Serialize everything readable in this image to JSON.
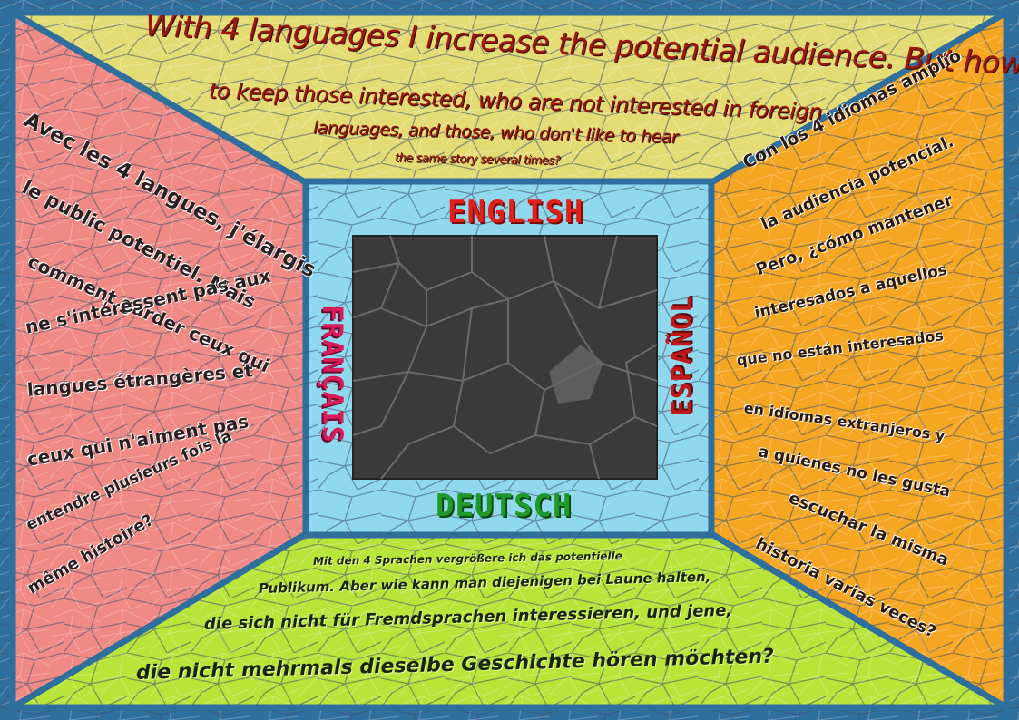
{
  "top_text": {
    "lines": [
      "With 4 languages I increase the potential audience. But how",
      "to keep those interested, who are not interested in foreign",
      "languages, and those, who don't like to hear",
      "the same story several times?"
    ]
  },
  "french_text": {
    "lines": [
      "Avec les 4 langues, j'élargis",
      "le public potentiel. Mais",
      "comment garder ceux qui",
      "ne s'intéressent pas aux",
      "langues étrangères et",
      "ceux qui n'aiment pas",
      "entendre plusieurs fois la",
      "même histoire?"
    ]
  },
  "spanish_text": {
    "lines": [
      "Con los 4 idiomas amplío",
      "la audiencia potencial.",
      "Pero, ¿cómo mantener",
      "interesados a aquellos",
      "que no están interesados",
      "en idiomas extranjeros y",
      "a quienes no les gusta",
      "escuchar la misma",
      "historia varias veces?"
    ]
  },
  "german_text": {
    "lines": [
      "Mit den 4 Sprachen vergrößere ich das potentielle",
      "Publikum. Aber wie kann man diejenigen bei Laune halten,",
      "die sich nicht für Fremdsprachen interessieren, und jene,",
      "die nicht mehrmals dieselbe Geschichte hören möchten?"
    ]
  },
  "labels": {
    "english": "ENGLISH",
    "francais": "FRANÇAIS",
    "espanol": "ESPAÑOL",
    "deutsch": "DEUTSCH"
  },
  "colors": {
    "frame": "#2f6f9e",
    "top_wall": "#e3dc74",
    "left_wall": "#f08a85",
    "right_wall": "#f5a623",
    "floor": "#b9e43a",
    "center_frame": "#8fd8ee",
    "screen": "#3a3a3a",
    "english_label": "#e0201a",
    "francais_label": "#d81b5a",
    "espanol_label": "#c01818",
    "deutsch_label": "#1f9a2a"
  }
}
